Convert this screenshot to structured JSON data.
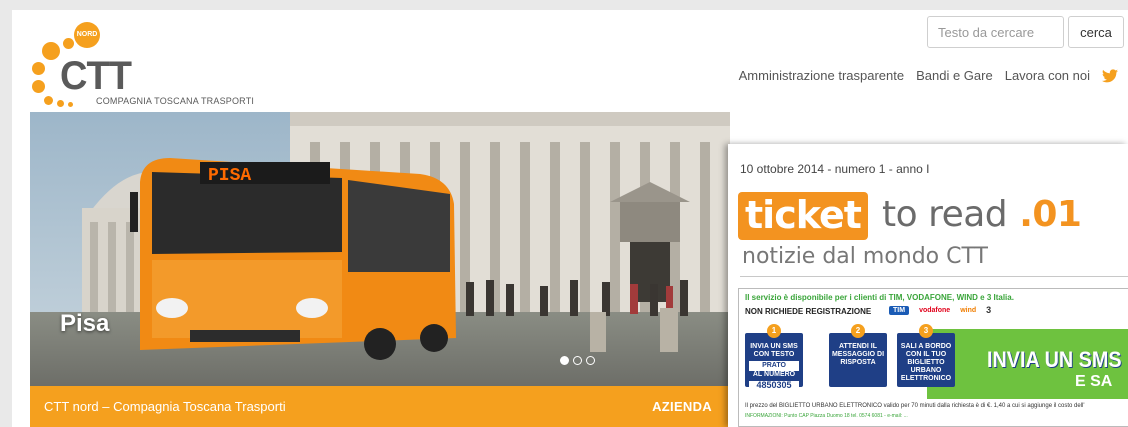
{
  "logo": {
    "badge": "NORD",
    "wordmark": "CTT",
    "subtitle": "COMPAGNIA TOSCANA TRASPORTI",
    "color": "#f5a01e"
  },
  "search": {
    "placeholder": "Testo da cercare",
    "button_label": "cerca"
  },
  "topnav": {
    "items": [
      "Amministrazione trasparente",
      "Bandi e Gare",
      "Lavora con noi"
    ],
    "social_icon": "twitter-icon"
  },
  "hero": {
    "caption": "Pisa",
    "bus_sign": "PISA",
    "slides_total": 3,
    "active_slide": 1
  },
  "orange_bar": {
    "left_text": "CTT nord – Compagnia Toscana Trasporti",
    "right_text": "AZIENDA",
    "color": "#f5a01e"
  },
  "newsletter": {
    "date": "10 ottobre 2014 - numero 1 - anno I",
    "title_ticket": "ticket",
    "title_toread": "to read",
    "title_suffix": ".01",
    "subtitle": "notizie dal mondo CTT",
    "ad": {
      "top_line": "Il servizio è disponibile per i clienti di TIM, VODAFONE, WIND e 3 Italia.",
      "no_registration": "NON RICHIEDE REGISTRAZIONE",
      "operators": [
        "TIM",
        "vodafone",
        "wind",
        "3"
      ],
      "step1_num": "1",
      "step1_text": "INVIA UN SMS CON TESTO",
      "step1_box": "PRATO",
      "step1_sub": "AL NUMERO",
      "step1_number": "4850305",
      "step2_num": "2",
      "step2_text": "ATTENDI IL MESSAGGIO DI RISPOSTA",
      "step3_num": "3",
      "step3_text": "SALI A BORDO CON IL TUO BIGLIETTO URBANO ELETTRONICO",
      "big_text": "INVIA UN SMS",
      "big_text2": "E SA",
      "footer": "Il prezzo del BIGLIETTO URBANO ELETTRONICO valido per 70 minuti dalla richiesta è di €. 1,40 a cui si aggiunge il costo dell'",
      "footer2": "INFORMAZIONI: Punto CAP Piazza Duomo 18 tel. 0574 6081 - e-mail: ..."
    }
  }
}
